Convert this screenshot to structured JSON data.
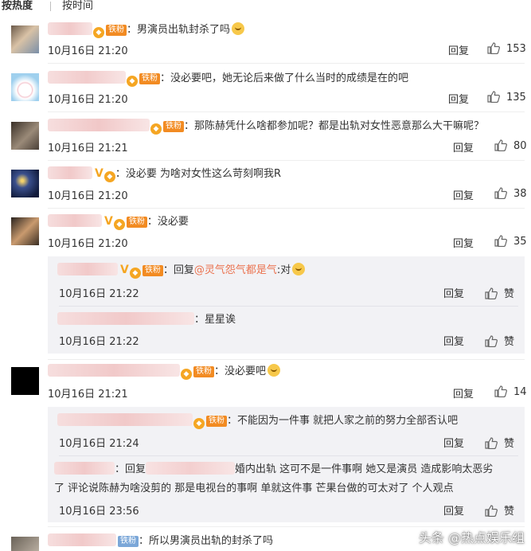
{
  "sort": {
    "by_heat": "按热度",
    "by_time": "按时间"
  },
  "reply_label": "回复",
  "like_label": "赞",
  "comments": [
    {
      "text": "：男演员出轨封杀了吗",
      "time": "10月16日 21:20",
      "likes": "153"
    },
    {
      "text": "：没必要吧，她无论后来做了什么当时的成绩是在的吧",
      "time": "10月16日 21:20",
      "likes": "135"
    },
    {
      "text": "：那陈赫凭什么啥都参加呢？都是出轨对女性恶意那么大干嘛呢？",
      "time": "10月16日 21:21",
      "likes": "80"
    },
    {
      "text": "：没必要 为啥对女性这么苛刻啊我R",
      "time": "10月16日 21:20",
      "likes": "38"
    },
    {
      "text": "：没必要",
      "time": "10月16日 21:20",
      "likes": "35"
    },
    {
      "text": "：没必要吧",
      "time": "10月16日 21:21",
      "likes": "14"
    },
    {
      "text": "：所以男演员出轨的封杀了吗",
      "badge": "铁粉"
    }
  ],
  "subreplies_a": [
    {
      "prefix": "：回复",
      "mention": "@灵气怨气都是气",
      "suffix": ":对",
      "time": "10月16日 21:22"
    },
    {
      "text": "：星星诶",
      "time": "10月16日 21:22"
    }
  ],
  "subreplies_b": [
    {
      "text": "：不能因为一件事 就把人家之前的努力全部否认吧",
      "time": "10月16日 21:24"
    },
    {
      "prefix": "：回复",
      "line1_rest": "婚内出轨 这可不是一件事啊 她又是演员 造成影响太恶劣",
      "line2": "了 评论说陈赫为啥没剪的  那是电视台的事啊 单就这件事 芒果台做的可太对了 个人观点",
      "time": "10月16日 23:56"
    }
  ],
  "badges": {
    "fan": "铁粉",
    "vip": "◆"
  },
  "watermark": "头条 @热点娱乐组",
  "colors": {
    "accent_orange": "#f28b22",
    "mention": "#eb7350",
    "reply_box": "#f2f2f5"
  }
}
